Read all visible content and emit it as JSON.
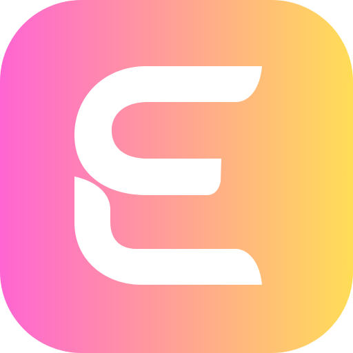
{
  "app_icon": {
    "icon_name": "stylized-letter-e-app-icon",
    "logo_text": "E",
    "colors": {
      "gradient_start": "#ff65d2",
      "gradient_end": "#ffdd57",
      "glyph": "#ffffff",
      "page_background": "#ffffff"
    }
  }
}
